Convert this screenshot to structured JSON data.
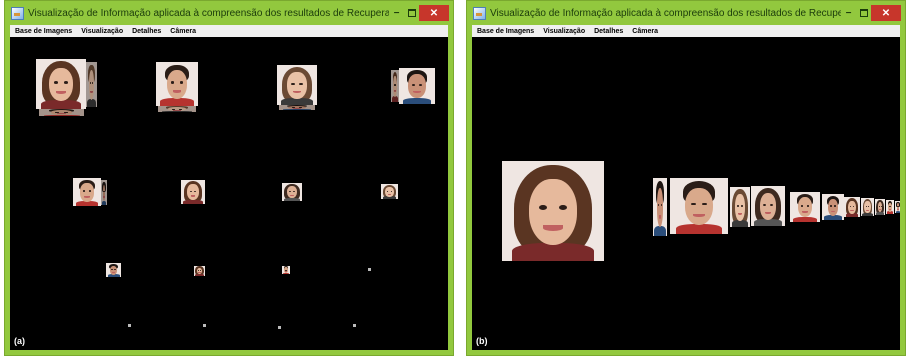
{
  "window_a": {
    "title": "Visualização de Informação aplicada à compreensão dos resultados de Recuperação de Imagens Baseada em Co...",
    "menu": [
      "Base de Imagens",
      "Visualização",
      "Detalhes",
      "Câmera"
    ],
    "panel_label": "(a)",
    "controls": {
      "minimize": "−",
      "close": "✕"
    }
  },
  "window_b": {
    "title": "Visualização de Informação aplicada à compreensão dos resultados de Recuperação de Imagens Baseada em Co...",
    "menu": [
      "Base de Imagens",
      "Visualização",
      "Detalhes",
      "Câmera"
    ],
    "panel_label": "(b)",
    "controls": {
      "minimize": "−",
      "close": "✕"
    }
  },
  "colors": {
    "titlebar": "#92c83e",
    "close_button": "#c7362b",
    "canvas": "#000000",
    "menubar": "#f0f0f0"
  },
  "icons": [
    "app-icon",
    "minimize-icon",
    "maximize-icon",
    "close-icon"
  ]
}
